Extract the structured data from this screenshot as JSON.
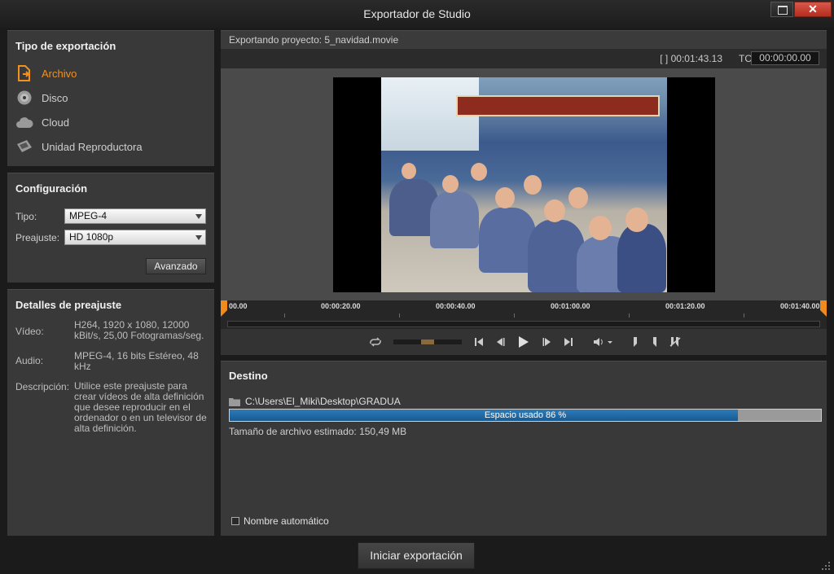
{
  "window": {
    "title": "Exportador de Studio",
    "close_glyph": "✕"
  },
  "export_type": {
    "heading": "Tipo de exportación",
    "items": [
      {
        "label": "Archivo",
        "icon": "file-export-icon",
        "active": true
      },
      {
        "label": "Disco",
        "icon": "disc-icon",
        "active": false
      },
      {
        "label": "Cloud",
        "icon": "cloud-icon",
        "active": false
      },
      {
        "label": "Unidad Reproductora",
        "icon": "device-icon",
        "active": false
      }
    ]
  },
  "config": {
    "heading": "Configuración",
    "type_label": "Tipo:",
    "type_value": "MPEG-4",
    "preset_label": "Preajuste:",
    "preset_value": "HD 1080p",
    "advanced_button": "Avanzado"
  },
  "preset_details": {
    "heading": "Detalles de preajuste",
    "video_label": "Vídeo:",
    "video_value": "H264, 1920 x 1080, 12000 kBit/s, 25,00 Fotogramas/seg.",
    "audio_label": "Audio:",
    "audio_value": "MPEG-4, 16 bits Estéreo, 48 kHz",
    "description_label": "Descripción:",
    "description_value": "Utilice este preajuste para crear vídeos de alta definición que desee reproducir en el ordenador o en un televisor de alta definición."
  },
  "preview": {
    "project_label": "Exportando proyecto: 5_navidad.movie",
    "duration": "[ ] 00:01:43.13",
    "tc_label": "TC",
    "tc_value": "00:00:00.00"
  },
  "timeline": {
    "ticks": [
      "00.00",
      "00:00:20.00",
      "00:00:40.00",
      "00:01:00.00",
      "00:01:20.00",
      "00:01:40.00"
    ]
  },
  "destination": {
    "heading": "Destino",
    "path": "C:\\Users\\El_Miki\\Desktop\\GRADUA",
    "usage_label": "Espacio usado 86 %",
    "usage_fraction": 0.86,
    "estimated_size": "Tamaño de archivo estimado: 150,49 MB",
    "auto_name_label": "Nombre automático",
    "auto_name_checked": false
  },
  "footer": {
    "start_button": "Iniciar exportación"
  },
  "colors": {
    "accent": "#f3911d",
    "usage_bar": "#1f6aa5",
    "close_button": "#c9402f"
  }
}
